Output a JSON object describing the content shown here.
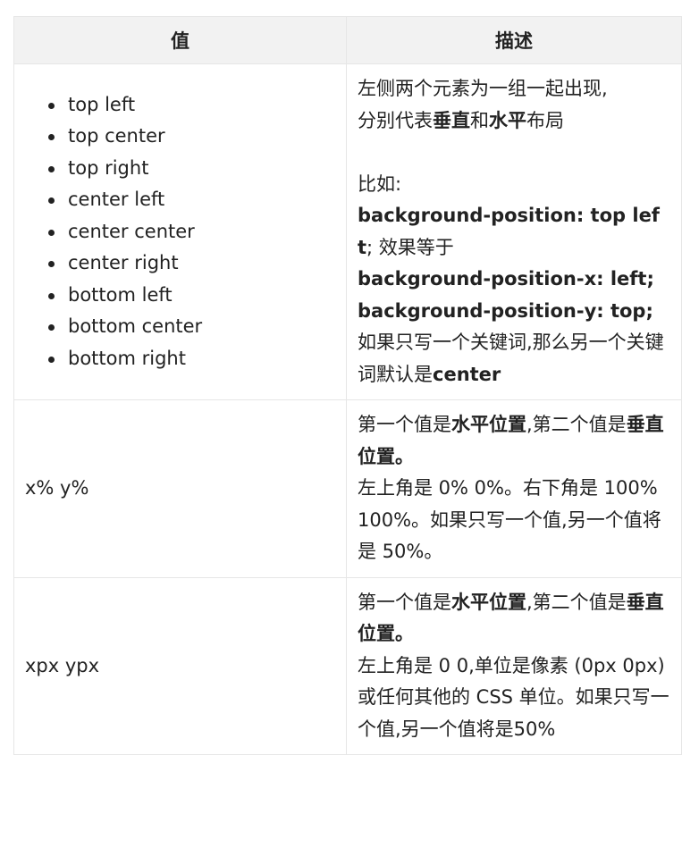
{
  "table": {
    "headers": [
      "值",
      "描述"
    ],
    "row1": {
      "values": [
        "top left",
        "top center",
        "top right",
        "center left",
        "center center",
        "center right",
        "bottom left",
        "bottom center",
        "bottom right"
      ],
      "desc": {
        "l1": "左侧两个元素为一组一起出现,",
        "l2a": "分别代表",
        "l2b": "垂直",
        "l2c": "和",
        "l2d": "水平",
        "l2e": "布局",
        "l3": "比如:",
        "l4a": "background-position: top left",
        "l4b": "; 效果等于",
        "l5": "background-position-x: left;",
        "l6": "background-position-y: top;",
        "l7a": "如果只写一个关键词,那么另一个关键词默认是",
        "l7b": "center"
      }
    },
    "row2": {
      "value": "x% y%",
      "desc": {
        "a": "第一个值是",
        "b": "水平位置",
        "c": ",第二个值是",
        "d": "垂直位置。",
        "e": "左上角是 0% 0%。右下角是 100% 100%。如果只写一个值,另一个值将是 50%。"
      }
    },
    "row3": {
      "value": "xpx ypx",
      "desc": {
        "a": "第一个值是",
        "b": "水平位置",
        "c": ",第二个值是",
        "d": "垂直位置。",
        "e": "左上角是 0 0,单位是像素 (0px 0px) 或任何其他的 CSS 单位。如果只写一个值,另一个值将是50%"
      }
    }
  }
}
